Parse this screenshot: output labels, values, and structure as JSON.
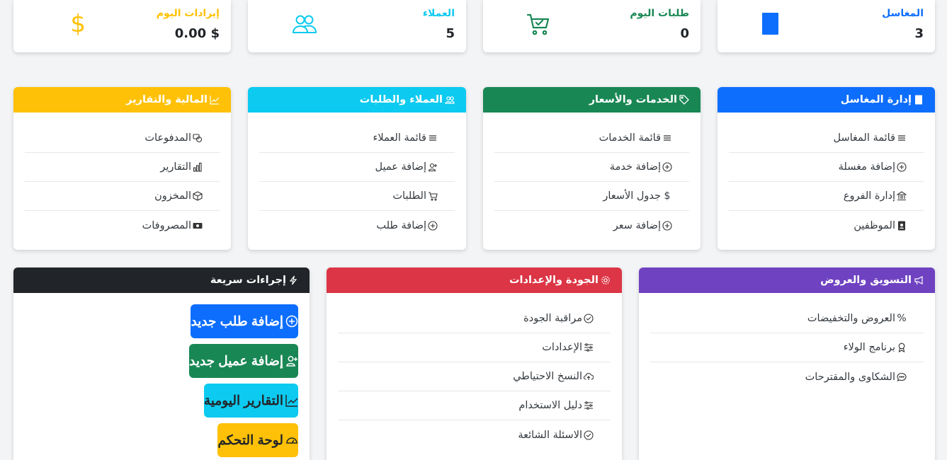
{
  "colors": {
    "primary": "#0d6efd",
    "success": "#198754",
    "info": "#0dcaf0",
    "warning": "#ffc107",
    "danger": "#dc3545",
    "dark": "#212529",
    "purple": "#6f42c1"
  },
  "stats": {
    "laundries": {
      "label": "المغاسل",
      "value": "3",
      "icon": "building-icon"
    },
    "orders_today": {
      "label": "طلبات اليوم",
      "value": "0",
      "icon": "cart-icon"
    },
    "customers": {
      "label": "العملاء",
      "value": "5",
      "icon": "people-icon"
    },
    "revenue_today": {
      "label": "إيرادات اليوم",
      "value": "$ 0.00",
      "icon": "dollar-icon"
    }
  },
  "cards": {
    "laundry_mgmt": {
      "title": "إدارة المغاسل",
      "items": [
        "قائمة المغاسل",
        "إضافة مغسلة",
        "إدارة الفروع",
        "الموظفين"
      ]
    },
    "services": {
      "title": "الخدمات والأسعار",
      "items": [
        "قائمة الخدمات",
        "إضافة خدمة",
        "جدول الأسعار",
        "إضافة سعر"
      ]
    },
    "customers": {
      "title": "العملاء والطلبات",
      "items": [
        "قائمة العملاء",
        "إضافة عميل",
        "الطلبات",
        "إضافة طلب"
      ]
    },
    "finance": {
      "title": "المالية والتقارير",
      "items": [
        "المدفوعات",
        "التقارير",
        "المخزون",
        "المصروفات"
      ]
    },
    "marketing": {
      "title": "التسويق والعروض",
      "items": [
        "العروض والتخفيضات",
        "برنامج الولاء",
        "الشكاوى والمقترحات"
      ]
    },
    "quality": {
      "title": "الجودة والإعدادات",
      "items": [
        "مراقبة الجودة",
        "الإعدادات",
        "النسخ الاحتياطي",
        "دليل الاستخدام",
        "الاسئلة الشائعة"
      ]
    },
    "quick_actions": {
      "title": "إجراءات سريعة",
      "buttons": [
        "إضافة طلب جديد",
        "إضافة عميل جديد",
        "التقارير اليومية",
        "لوحة التحكم"
      ]
    }
  }
}
